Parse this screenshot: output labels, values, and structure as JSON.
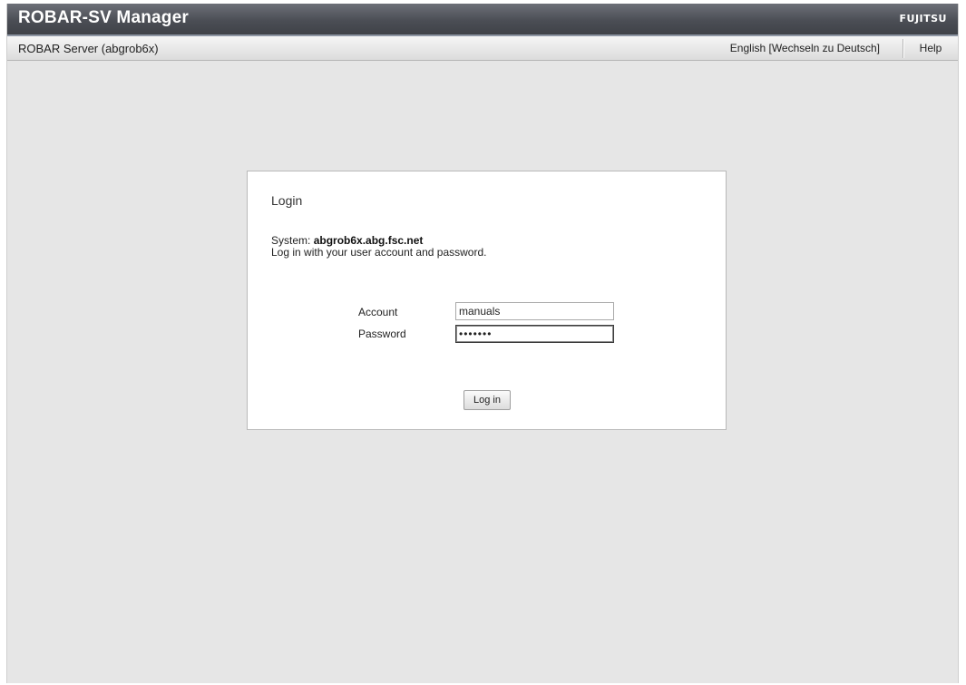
{
  "app": {
    "title": "ROBAR-SV Manager",
    "brand": "FUJITSU"
  },
  "infobar": {
    "server": "ROBAR Server (abgrob6x)",
    "language": "English [Wechseln zu Deutsch]",
    "help": "Help"
  },
  "login": {
    "heading": "Login",
    "system_label": "System: ",
    "system_value": "abgrob6x.abg.fsc.net",
    "hint": "Log in with your user account and password.",
    "account_label": "Account",
    "account_value": "manuals",
    "password_label": "Password",
    "password_value": "•••••••",
    "button_label": "Log in"
  },
  "colors": {
    "titlebar": "#4b4e55",
    "background": "#e6e6e6",
    "panel": "#ffffff"
  }
}
